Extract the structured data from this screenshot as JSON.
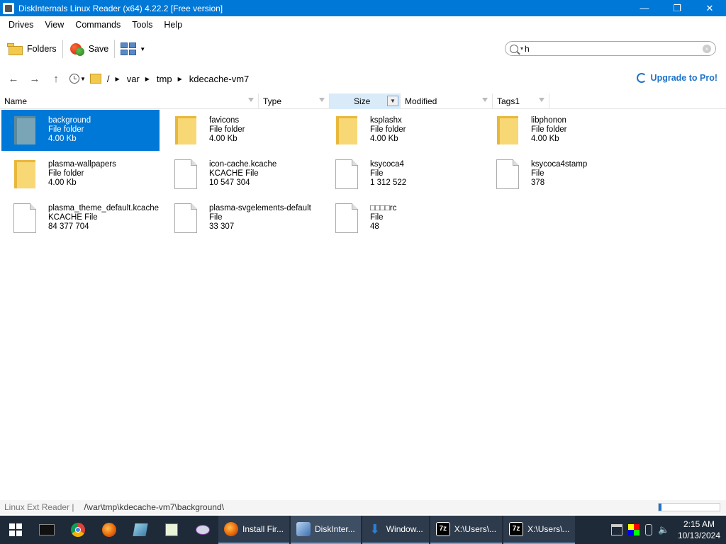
{
  "window": {
    "title": "DiskInternals Linux Reader (x64) 4.22.2 [Free version]",
    "minimize": "—",
    "maximize": "❐",
    "close": "✕"
  },
  "menu": [
    "Drives",
    "View",
    "Commands",
    "Tools",
    "Help"
  ],
  "toolbar": {
    "folders_label": "Folders",
    "save_label": "Save"
  },
  "search": {
    "value": "h"
  },
  "address": {
    "back": "←",
    "forward": "→",
    "up": "↑",
    "root": "/",
    "crumbs": [
      "var",
      "tmp",
      "kdecache-vm7"
    ],
    "upgrade_label": "Upgrade to Pro!"
  },
  "columns": [
    "Name",
    "Type",
    "Size",
    "Modified",
    "Tags1"
  ],
  "files": [
    {
      "name": "background",
      "type": "File folder",
      "size": "4.00 Kb",
      "kind": "folder",
      "selected": true
    },
    {
      "name": "favicons",
      "type": "File folder",
      "size": "4.00 Kb",
      "kind": "folder"
    },
    {
      "name": "ksplashx",
      "type": "File folder",
      "size": "4.00 Kb",
      "kind": "folder"
    },
    {
      "name": "libphonon",
      "type": "File folder",
      "size": "4.00 Kb",
      "kind": "folder"
    },
    {
      "name": "plasma-wallpapers",
      "type": "File folder",
      "size": "4.00 Kb",
      "kind": "folder"
    },
    {
      "name": "icon-cache.kcache",
      "type": "KCACHE File",
      "size": "10 547 304",
      "kind": "file"
    },
    {
      "name": "ksycoca4",
      "type": "File",
      "size": "1 312 522",
      "kind": "file"
    },
    {
      "name": "ksycoca4stamp",
      "type": "File",
      "size": "378",
      "kind": "file"
    },
    {
      "name": "plasma_theme_default.kcache",
      "type": "KCACHE File",
      "size": "84 377 704",
      "kind": "file"
    },
    {
      "name": "plasma-svgelements-default",
      "type": "File",
      "size": "33 307",
      "kind": "file"
    },
    {
      "name": "□□□□rc",
      "type": "File",
      "size": "48",
      "kind": "file"
    }
  ],
  "status": {
    "app": "Linux Ext Reader |",
    "path": "/\\var\\tmp\\kdecache-vm7\\background\\",
    "progress": 0.05
  },
  "taskbar": {
    "apps": [
      {
        "label": "Install Fir...",
        "color": "#e66000"
      },
      {
        "label": "DiskInter...",
        "color": "#4a7fc1",
        "active": true
      },
      {
        "label": "Window...",
        "color": "#2b7fd6"
      },
      {
        "label": "X:\\Users\\...",
        "color": "#ffffff"
      },
      {
        "label": "X:\\Users\\...",
        "color": "#ffffff"
      }
    ],
    "time": "2:15 AM",
    "date": "10/13/2024"
  }
}
